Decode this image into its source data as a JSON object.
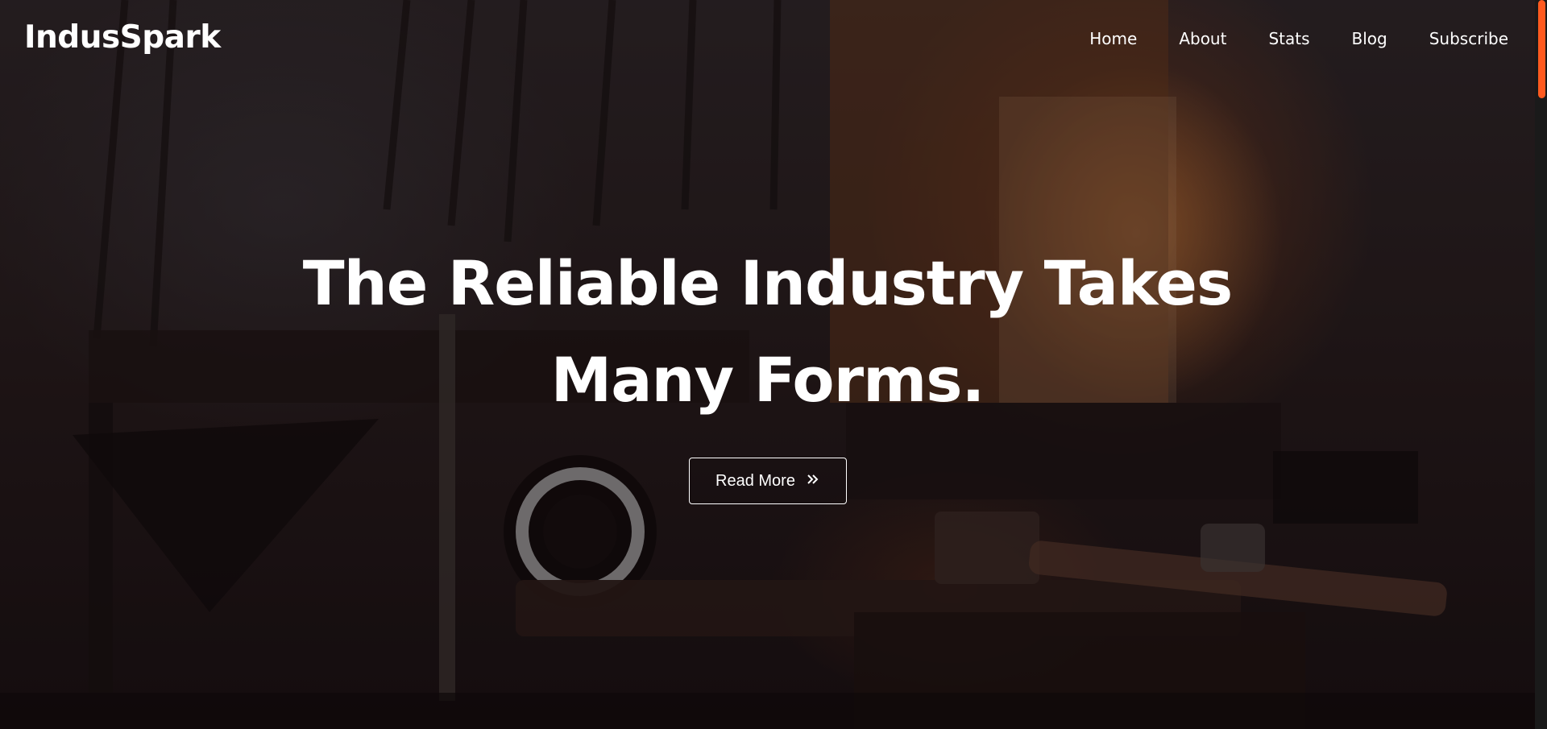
{
  "navbar": {
    "logo": "IndusSpark",
    "items": [
      {
        "label": "Home"
      },
      {
        "label": "About"
      },
      {
        "label": "Stats"
      },
      {
        "label": "Blog"
      },
      {
        "label": "Subscribe"
      }
    ]
  },
  "hero": {
    "title_line1": "The Reliable Industry Takes",
    "title_line2": "Many Forms.",
    "button_label": "Read More",
    "button_icon": "double-chevron-right-icon"
  },
  "theme": {
    "accent": "#ff5a1f",
    "text": "#ffffff"
  }
}
